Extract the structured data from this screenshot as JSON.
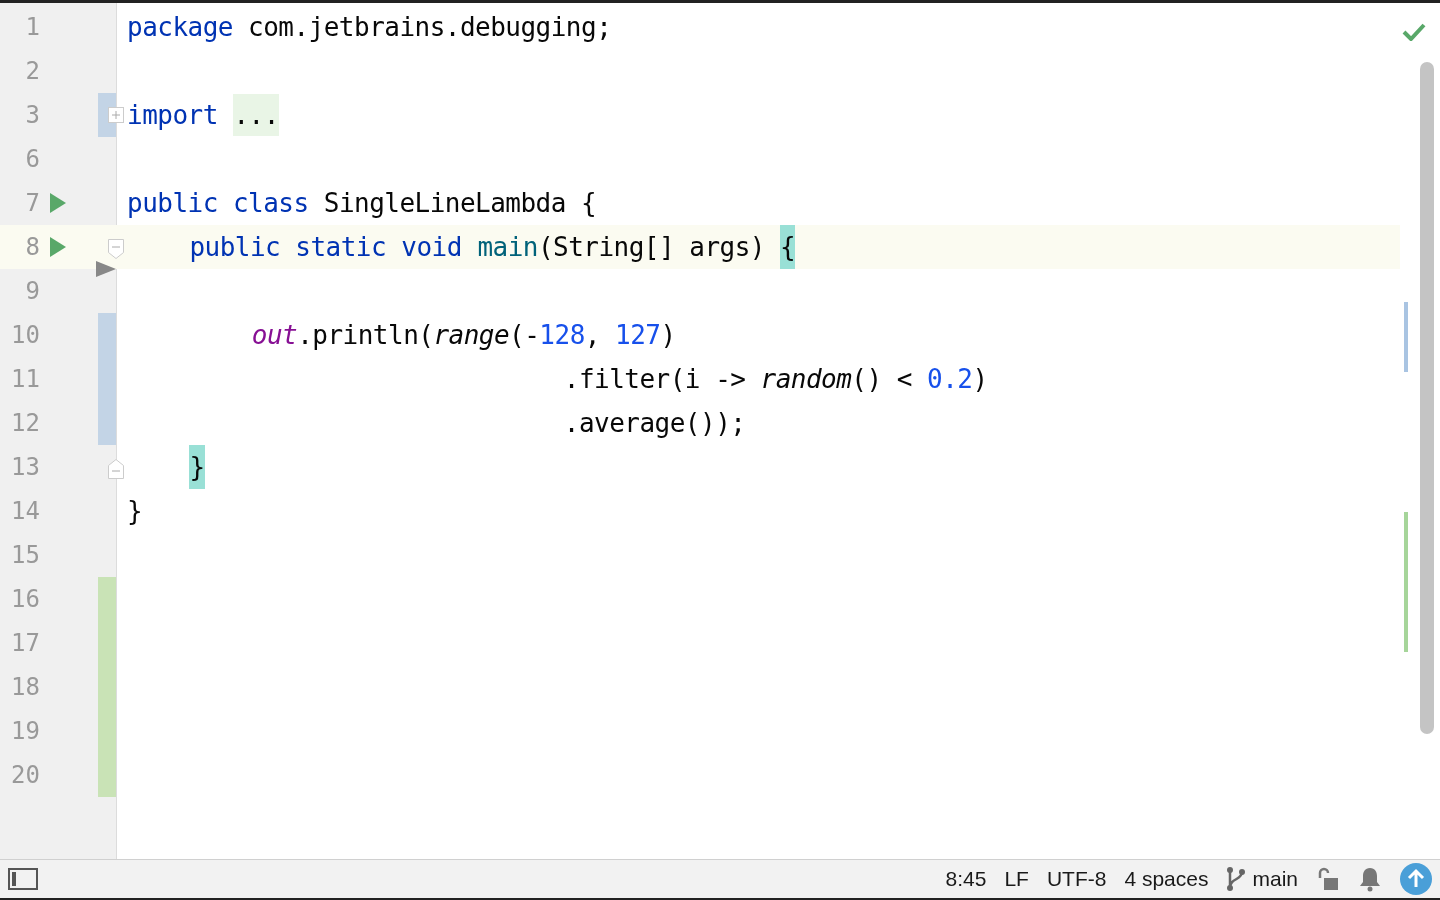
{
  "editor": {
    "lines": [
      {
        "number": "1",
        "kind": "top",
        "current": false,
        "tokens": [
          {
            "kind": "keyword",
            "text": "package"
          },
          {
            "kind": "plain",
            "text": " com.jetbrains.debugging;"
          }
        ]
      },
      {
        "number": "2",
        "current": false
      },
      {
        "number": "3",
        "kind": "top",
        "current": false,
        "gutter": [
          {
            "kind": "modified"
          },
          {
            "kind": "expand"
          }
        ],
        "tokens": [
          {
            "kind": "keyword",
            "text": "import"
          },
          {
            "kind": "folded",
            "text": "..."
          }
        ]
      },
      {
        "number": "6",
        "current": false
      },
      {
        "number": "7",
        "kind": "top",
        "current": false,
        "gutter": [
          {
            "kind": "run"
          }
        ],
        "tokens": [
          {
            "kind": "keyword",
            "text": "public class"
          },
          {
            "kind": "plain",
            "text": " SingleLineLambda {"
          }
        ]
      },
      {
        "number": "8",
        "kind": "member",
        "current": true,
        "gutter": [
          {
            "kind": "run"
          },
          {
            "kind": "fold-start"
          }
        ],
        "tokens": [
          {
            "kind": "keyword",
            "text": "public static void"
          },
          {
            "kind": "declaration",
            "text": "main"
          },
          {
            "kind": "plain",
            "text": "(String[] args) "
          },
          {
            "kind": "brace-match",
            "text": "{"
          }
        ]
      },
      {
        "number": "9",
        "current": false
      },
      {
        "number": "10",
        "kind": "statement",
        "current": false,
        "gutter": [
          {
            "kind": "modified"
          }
        ],
        "tokens": [
          {
            "kind": "static-field",
            "text": "out"
          },
          {
            "kind": "plain",
            "text": ".println("
          },
          {
            "kind": "static-call",
            "text": "range"
          },
          {
            "kind": "plain",
            "text": "(-"
          },
          {
            "kind": "number",
            "text": "128"
          },
          {
            "kind": "plain",
            "text": ", "
          },
          {
            "kind": "number",
            "text": "127"
          },
          {
            "kind": "plain",
            "text": ")"
          }
        ]
      },
      {
        "number": "11",
        "kind": "continuation",
        "current": false,
        "gutter": [
          {
            "kind": "modified"
          }
        ],
        "tokens": [
          {
            "kind": "plain",
            "text": ".filter(i -> "
          },
          {
            "kind": "static-call",
            "text": "random"
          },
          {
            "kind": "plain",
            "text": "() < "
          },
          {
            "kind": "number",
            "text": "0.2"
          },
          {
            "kind": "plain",
            "text": ")"
          }
        ]
      },
      {
        "number": "12",
        "kind": "continuation",
        "current": false,
        "gutter": [
          {
            "kind": "modified"
          }
        ],
        "tokens": [
          {
            "kind": "plain",
            "text": ".average());"
          }
        ]
      },
      {
        "number": "13",
        "kind": "member",
        "current": false,
        "gutter": [
          {
            "kind": "fold-end"
          }
        ],
        "tokens": [
          {
            "kind": "brace-match",
            "text": "}"
          }
        ]
      },
      {
        "number": "14",
        "kind": "top",
        "current": false,
        "tokens": [
          {
            "kind": "plain",
            "text": "}"
          }
        ]
      },
      {
        "number": "15",
        "current": false
      },
      {
        "number": "16",
        "current": false,
        "gutter": [
          {
            "kind": "added"
          }
        ]
      },
      {
        "number": "17",
        "current": false,
        "gutter": [
          {
            "kind": "added"
          }
        ]
      },
      {
        "number": "18",
        "current": false,
        "gutter": [
          {
            "kind": "added"
          }
        ]
      },
      {
        "number": "19",
        "current": false,
        "gutter": [
          {
            "kind": "added"
          }
        ]
      },
      {
        "number": "20",
        "current": false,
        "gutter": [
          {
            "kind": "added"
          }
        ]
      }
    ]
  },
  "status_bar": {
    "position": "8:45",
    "line_separator": "LF",
    "encoding": "UTF-8",
    "indent": "4 spaces",
    "branch": "main"
  }
}
